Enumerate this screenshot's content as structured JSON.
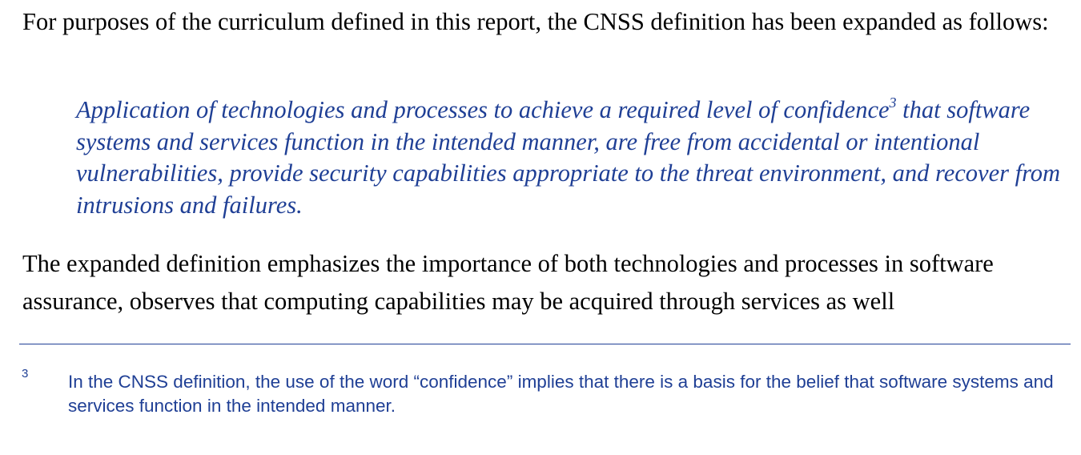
{
  "paragraphs": {
    "intro": "For purposes of the curriculum defined in this report, the CNSS definition has been expanded as follows:",
    "followup": "The expanded definition emphasizes the importance of both technologies and processes in software assurance, observes that computing capabilities may be acquired through services as well"
  },
  "quote": {
    "before_ref": "Application of technologies and processes to achieve a required level of confidence",
    "ref": "3",
    "after_ref": " that software systems and services function in the intended manner, are free from accidental or intentional vulnerabilities, provide security capabilities appropriate to the threat environment, and recover from intrusions and failures."
  },
  "footnote": {
    "number": "3",
    "text": "In the CNSS definition, the use of the word “confidence” implies that there is a basis for the belief that software systems and services function in the intended manner."
  },
  "colors": {
    "body_text": "#000000",
    "accent_blue": "#1f3f95"
  }
}
